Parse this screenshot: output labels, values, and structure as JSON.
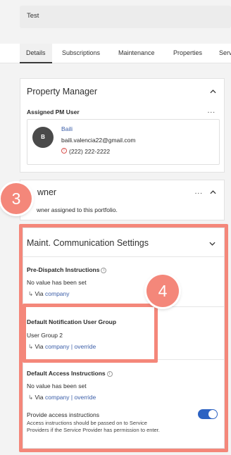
{
  "header": {
    "title": "Test"
  },
  "tabs": [
    {
      "label": "Details"
    },
    {
      "label": "Subscriptions"
    },
    {
      "label": "Maintenance"
    },
    {
      "label": "Properties"
    },
    {
      "label": "Serv"
    }
  ],
  "property_manager": {
    "title": "Property Manager",
    "assigned_label": "Assigned PM User",
    "more_label": "...",
    "user": {
      "initial": "B",
      "name": "Baili",
      "email": "baili.valencia22@gmail.com",
      "phone": "(222) 222-2222"
    }
  },
  "owner": {
    "title": "wner",
    "more_label": "...",
    "message": "wner assigned to this portfolio."
  },
  "maint_settings": {
    "title": "Maint. Communication Settings",
    "pre_dispatch": {
      "title": "Pre-Dispatch Instructions",
      "value": "No value has been set",
      "via_label": "Via",
      "via_link": "company"
    },
    "notification_group": {
      "title": "Default Notification User Group",
      "value": "User Group 2",
      "via_label": "Via",
      "via_link": "company",
      "separator": "|",
      "override_link": "override"
    },
    "access": {
      "title": "Default Access Instructions",
      "value": "No value has been set",
      "via_label": "Via",
      "via_link": "company",
      "separator": "|",
      "override_link": "override",
      "provide_title": "Provide access instructions",
      "provide_desc": "Access instructions should be passed on to Service Providers if the Service Provider has permission to enter.",
      "provide_enabled": true
    }
  },
  "callouts": {
    "three": "3",
    "four": "4"
  },
  "colors": {
    "accent": "#2c62c2",
    "link": "#3b5ea8",
    "callout": "#f4877a",
    "alert": "#d9534f"
  }
}
